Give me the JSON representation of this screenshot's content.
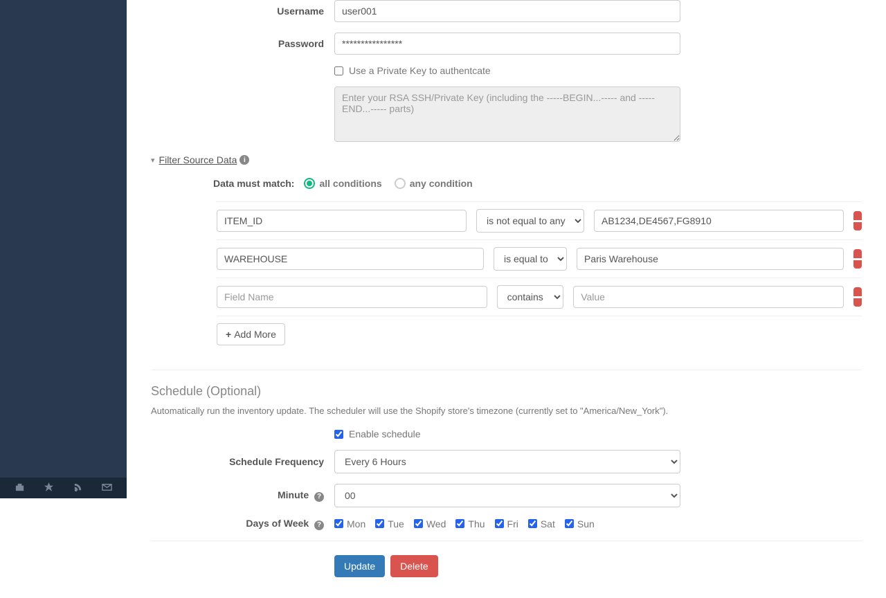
{
  "auth": {
    "username_label": "Username",
    "username_value": "user001",
    "password_label": "Password",
    "password_value": "****************",
    "private_key_label": "Use a Private Key to authentcate",
    "private_key_placeholder": "Enter your RSA SSH/Private Key (including the -----BEGIN...----- and -----END...----- parts)"
  },
  "filter": {
    "section_title": "Filter Source Data",
    "match_label": "Data must match:",
    "all_label": "all conditions",
    "any_label": "any condition",
    "field_placeholder": "Field Name",
    "value_placeholder": "Value",
    "add_more_label": "Add More",
    "rows": [
      {
        "field": "ITEM_ID",
        "op": "is not equal to any",
        "value": "AB1234,DE4567,FG8910"
      },
      {
        "field": "WAREHOUSE",
        "op": "is equal to",
        "value": "Paris Warehouse"
      },
      {
        "field": "",
        "op": "contains",
        "value": ""
      }
    ]
  },
  "schedule": {
    "title": "Schedule (Optional)",
    "desc": "Automatically run the inventory update. The scheduler will use the Shopify store's timezone (currently set to \"America/New_York\").",
    "enable_label": "Enable schedule",
    "frequency_label": "Schedule Frequency",
    "frequency_value": "Every 6 Hours",
    "minute_label": "Minute",
    "minute_value": "00",
    "days_label": "Days of Week",
    "days": [
      "Mon",
      "Tue",
      "Wed",
      "Thu",
      "Fri",
      "Sat",
      "Sun"
    ]
  },
  "actions": {
    "update": "Update",
    "delete": "Delete"
  }
}
